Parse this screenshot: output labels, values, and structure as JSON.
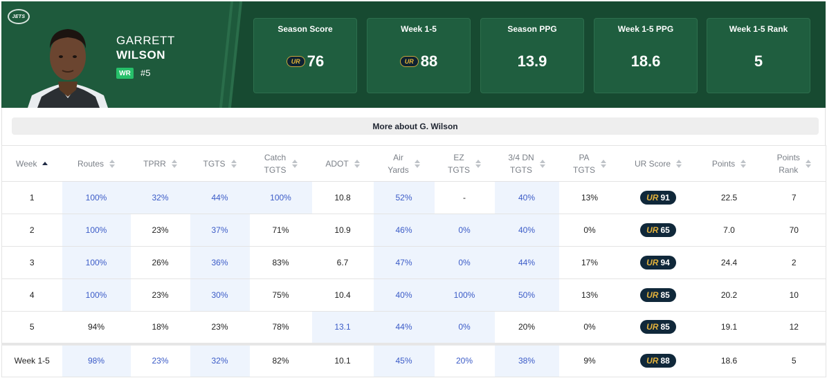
{
  "team": {
    "logo_text": "JETS"
  },
  "player": {
    "first_name": "GARRETT",
    "last_name": "WILSON",
    "position": "WR",
    "number": "#5"
  },
  "stat_cards": [
    {
      "label": "Season Score",
      "value": "76",
      "ur": true
    },
    {
      "label": "Week 1-5",
      "value": "88",
      "ur": true
    },
    {
      "label": "Season PPG",
      "value": "13.9",
      "ur": false
    },
    {
      "label": "Week 1-5 PPG",
      "value": "18.6",
      "ur": false
    },
    {
      "label": "Week 1-5 Rank",
      "value": "5",
      "ur": false
    }
  ],
  "ur_logo_text": "UR",
  "more_button": "More about G. Wilson",
  "columns": [
    {
      "l1": "Week",
      "l2": ""
    },
    {
      "l1": "Routes",
      "l2": ""
    },
    {
      "l1": "TPRR",
      "l2": ""
    },
    {
      "l1": "TGTS",
      "l2": ""
    },
    {
      "l1": "Catch",
      "l2": "TGTS"
    },
    {
      "l1": "ADOT",
      "l2": ""
    },
    {
      "l1": "Air",
      "l2": "Yards"
    },
    {
      "l1": "EZ",
      "l2": "TGTS"
    },
    {
      "l1": "3/4 DN",
      "l2": "TGTS"
    },
    {
      "l1": "PA",
      "l2": "TGTS"
    },
    {
      "l1": "UR Score",
      "l2": ""
    },
    {
      "l1": "Points",
      "l2": ""
    },
    {
      "l1": "Points",
      "l2": "Rank"
    }
  ],
  "rows": [
    [
      "1",
      "100%",
      "32%",
      "44%",
      "100%",
      "10.8",
      "52%",
      "-",
      "40%",
      "13%",
      "91",
      "22.5",
      "7"
    ],
    [
      "2",
      "100%",
      "23%",
      "37%",
      "71%",
      "10.9",
      "46%",
      "0%",
      "40%",
      "0%",
      "65",
      "7.0",
      "70"
    ],
    [
      "3",
      "100%",
      "26%",
      "36%",
      "83%",
      "6.7",
      "47%",
      "0%",
      "44%",
      "17%",
      "94",
      "24.4",
      "2"
    ],
    [
      "4",
      "100%",
      "23%",
      "30%",
      "75%",
      "10.4",
      "40%",
      "100%",
      "50%",
      "13%",
      "85",
      "20.2",
      "10"
    ],
    [
      "5",
      "94%",
      "18%",
      "23%",
      "78%",
      "13.1",
      "44%",
      "0%",
      "20%",
      "0%",
      "85",
      "19.1",
      "12"
    ]
  ],
  "total_row": [
    "Week 1-5",
    "98%",
    "23%",
    "32%",
    "82%",
    "10.1",
    "45%",
    "20%",
    "38%",
    "9%",
    "88",
    "18.6",
    "5"
  ],
  "highlights": [
    [
      1,
      2,
      3,
      4,
      6,
      8
    ],
    [
      1,
      3,
      6,
      7,
      8
    ],
    [
      1,
      3,
      6,
      7,
      8
    ],
    [
      1,
      3,
      6,
      7,
      8
    ],
    [
      5,
      6,
      7
    ]
  ],
  "total_blue": [
    1,
    2,
    3,
    6,
    7,
    8
  ],
  "total_highlights": [
    1,
    3,
    6,
    8
  ],
  "colors": {
    "header_green": "#1e5a3c",
    "position_badge": "#27c06a",
    "highlight_bg": "#eef4fd",
    "highlight_text": "#3b5bc7",
    "ur_badge_bg": "#10283a",
    "ur_gold": "#e3b23c"
  }
}
